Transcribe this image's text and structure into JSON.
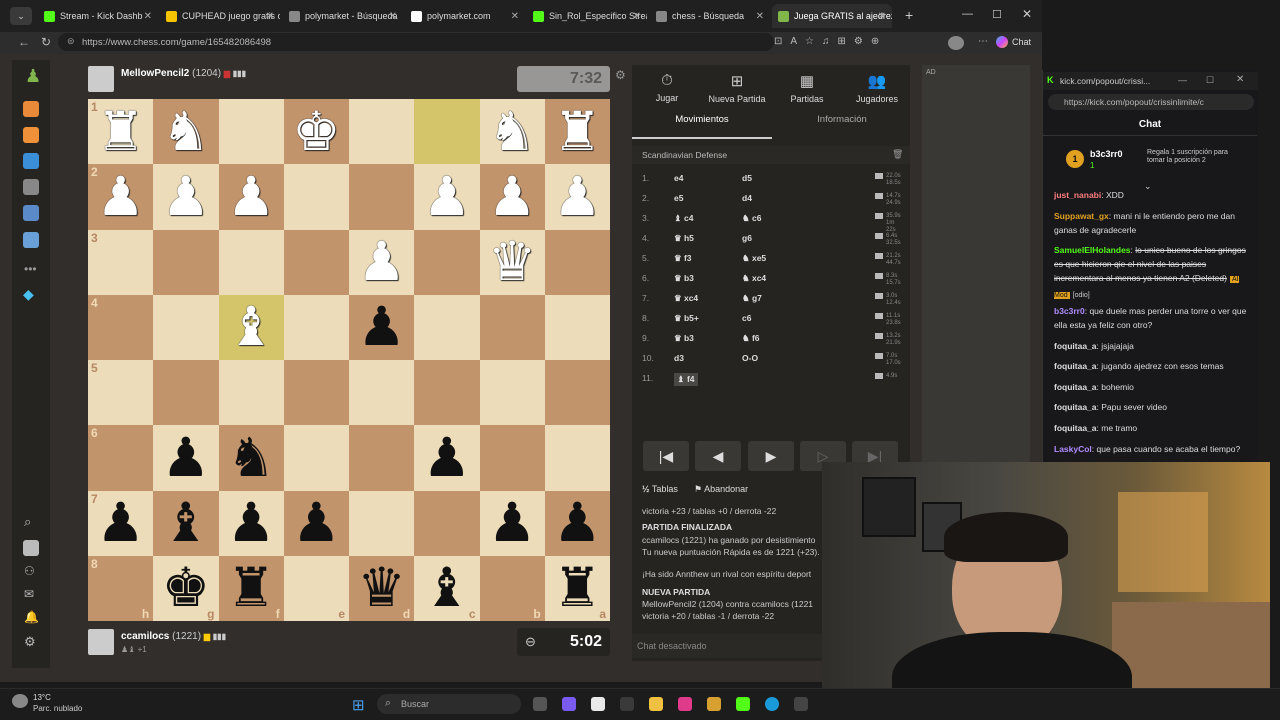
{
  "browser": {
    "tabs": [
      {
        "label": "Stream - Kick Dashb",
        "color": "#53fc18"
      },
      {
        "label": "CUPHEAD juego gratis c",
        "color": "#f5c400"
      },
      {
        "label": "polymarket - Búsqueda",
        "color": "#888888"
      },
      {
        "label": "polymarket.com",
        "color": "#ffffff"
      },
      {
        "label": "Sin_Rol_Especifico Strea",
        "color": "#53fc18"
      },
      {
        "label": "chess - Búsqueda",
        "color": "#888888"
      },
      {
        "label": "Juega GRATIS al ajedrez",
        "color": "#81b64c"
      }
    ],
    "url": "https://www.chess.com/game/165482086498",
    "chat_label": "Chat"
  },
  "game": {
    "top_player": {
      "name": "MellowPencil2",
      "rating": "(1204)",
      "clock": "7:32"
    },
    "bottom_player": {
      "name": "ccamilocs",
      "rating": "(1221)",
      "sub": "+1",
      "clock": "5:02"
    },
    "board": [
      [
        "wR",
        "wN",
        "",
        "wK",
        "",
        "",
        "wN",
        "wR"
      ],
      [
        "wP",
        "wP",
        "wP",
        "",
        "",
        "wP",
        "wP",
        "wP"
      ],
      [
        "",
        "",
        "",
        "",
        "wP",
        "",
        "wQ",
        ""
      ],
      [
        "",
        "",
        "wB",
        "",
        "bP",
        "",
        "",
        ""
      ],
      [
        "",
        "",
        "",
        "",
        "",
        "",
        "",
        ""
      ],
      [
        "",
        "bP",
        "bN",
        "",
        "",
        "bP",
        "",
        ""
      ],
      [
        "bP",
        "bB",
        "bP",
        "bP",
        "",
        "",
        "bP",
        "bP"
      ],
      [
        "",
        "bK",
        "bR",
        "",
        "bQ",
        "bB",
        "",
        "bR"
      ]
    ],
    "highlights": [
      "r0c5",
      "r3c2"
    ],
    "rank_labels": [
      "1",
      "2",
      "3",
      "4",
      "5",
      "6",
      "7",
      "8"
    ],
    "file_labels": [
      "h",
      "g",
      "f",
      "e",
      "d",
      "c",
      "b",
      "a"
    ]
  },
  "panel": {
    "tabs": [
      {
        "icon": "⏱",
        "label": "Jugar"
      },
      {
        "icon": "⊞",
        "label": "Nueva Partida"
      },
      {
        "icon": "▦",
        "label": "Partidas"
      },
      {
        "icon": "👥",
        "label": "Jugadores"
      }
    ],
    "subtabs": {
      "moves": "Movimientos",
      "info": "Información"
    },
    "opening": "Scandinavian Defense",
    "moves": [
      {
        "n": "1.",
        "w": "e4",
        "b": "d5",
        "t1": "22.0s",
        "t2": "18.5s"
      },
      {
        "n": "2.",
        "w": "e5",
        "b": "d4",
        "t1": "14.7s",
        "t2": "24.9s"
      },
      {
        "n": "3.",
        "w": "♝ c4",
        "b": "♞ c6",
        "t1": "35.9s",
        "t2": "1m 22s"
      },
      {
        "n": "4.",
        "w": "♛ h5",
        "b": "g6",
        "t1": "6.4s",
        "t2": "32.5s"
      },
      {
        "n": "5.",
        "w": "♛ f3",
        "b": "♞ xe5",
        "t1": "21.2s",
        "t2": "44.7s"
      },
      {
        "n": "6.",
        "w": "♛ b3",
        "b": "♞ xc4",
        "t1": "8.3s",
        "t2": "15.7s"
      },
      {
        "n": "7.",
        "w": "♛ xc4",
        "b": "♞ g7",
        "t1": "3.0s",
        "t2": "12.4s"
      },
      {
        "n": "8.",
        "w": "♛ b5+",
        "b": "c6",
        "t1": "11.1s",
        "t2": "23.8s"
      },
      {
        "n": "9.",
        "w": "♛ b3",
        "b": "♞ f6",
        "t1": "13.2s",
        "t2": "21.9s"
      },
      {
        "n": "10.",
        "w": "d3",
        "b": "O-O",
        "t1": "7.0s",
        "t2": "17.0s"
      },
      {
        "n": "11.",
        "w": "♝ f4",
        "b": "",
        "t1": "4.9s",
        "t2": ""
      }
    ],
    "draw_label": "Tablas",
    "resign_label": "Abandonar",
    "log": {
      "line1": "victoria +23 / tablas +0 / derrota -22",
      "finished_title": "PARTIDA FINALIZADA",
      "finished_body1": "ccamilocs (1221) ha ganado por desistimiento",
      "finished_body2": "Tu nueva puntuación Rápida es de 1221 (+23).",
      "rival": "¡Ha sido Annthew un rival con espíritu deport",
      "new_title": "NUEVA PARTIDA",
      "new_body1": "MellowPencil2 (1204) contra ccamilocs (1221",
      "new_body2": "victoria +20 / tablas -1 / derrota -22"
    },
    "chat_disabled": "Chat desactivado"
  },
  "ad": {
    "label": "AD"
  },
  "kick": {
    "url": "https://kick.com/popout/crissinlimite/c",
    "tab_url": "kick.com/popout/crissi...",
    "title": "Chat",
    "gift_user": "b3c3rr0",
    "gift_count": "1",
    "gift_text": "Regala 1 suscripción para tomar la posición 2",
    "messages": [
      {
        "user": "just_nanabi",
        "color": "#ff7d7d",
        "text": "XDD"
      },
      {
        "user": "Suppawat_gx",
        "color": "#e0a020",
        "text": "mani ni le entiendo pero me dan ganas de agradecerle"
      },
      {
        "user": "SamuelElHolandes",
        "color": "#53fc18",
        "text": "lo unico bueno de los gringos es que hicieron qie el nivel de las paises incrementara al menos ya tienen A2 (Deleted)"
      },
      {
        "user": "b3c3rr0",
        "color": "#b18cff",
        "text": "que duele mas perder una torre o ver que ella esta ya feliz con otro?"
      },
      {
        "user": "foquitaa_a",
        "color": "#dddddd",
        "text": "jsjajajaja"
      },
      {
        "user": "foquitaa_a",
        "color": "#dddddd",
        "text": "jugando ajedrez con esos temas"
      },
      {
        "user": "foquitaa_a",
        "color": "#dddddd",
        "text": "bohemio"
      },
      {
        "user": "foquitaa_a",
        "color": "#dddddd",
        "text": "Papu sever video"
      },
      {
        "user": "foquitaa_a",
        "color": "#dddddd",
        "text": "me tramo"
      },
      {
        "user": "LaskyCol",
        "color": "#b18cff",
        "text": "que pasa cuando se acaba el tiempo?"
      }
    ],
    "ai_mod_badge": "AI Mod",
    "odio_badge": "[odio]"
  },
  "taskbar": {
    "weather_temp": "13°C",
    "weather_desc": "Parc. nublado",
    "search_placeholder": "Buscar"
  }
}
